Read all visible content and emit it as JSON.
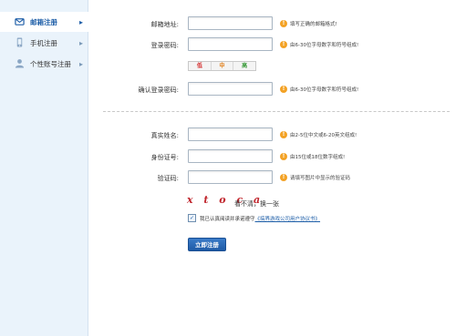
{
  "sidebar": {
    "items": [
      {
        "label": "邮箱注册",
        "icon": "mail-icon",
        "active": true
      },
      {
        "label": "手机注册",
        "icon": "phone-icon",
        "active": false
      },
      {
        "label": "个性账号注册",
        "icon": "user-icon",
        "active": false
      }
    ],
    "chevron": "▸"
  },
  "form": {
    "email": {
      "label": "邮箱地址:",
      "value": "",
      "hint": "填写正确的邮箱格式!"
    },
    "password": {
      "label": "登录密码:",
      "value": "",
      "hint": "由6-30位字母数字和符号组成!"
    },
    "strength": {
      "weak": "低",
      "medium": "中",
      "strong": "高"
    },
    "confirm_password": {
      "label": "确认登录密码:",
      "value": "",
      "hint": "由6-30位字母数字和符号组成!"
    },
    "real_name": {
      "label": "真实姓名:",
      "value": "",
      "hint": "由2-5位中文或6-20英文组成!"
    },
    "id_number": {
      "label": "身份证号:",
      "value": "",
      "hint": "由15位或18位数字组成!"
    },
    "captcha_code": {
      "label": "验证码:",
      "value": "",
      "hint": "请填写图片中显示的验证码"
    },
    "captcha_text": "x t o c a",
    "refresh_label": "看不清，换一张",
    "agreement_text": "我已认真阅读并承诺遵守",
    "agreement_link": "《搞界游戏公司用户协议书》",
    "agreement_checked": true,
    "submit_label": "立即注册"
  },
  "colors": {
    "accent": "#1f5fa8",
    "sidebar_bg": "#eaf3fb",
    "warning": "#f3a225",
    "captcha": "#c0262d",
    "strength_weak": "#d42b2b",
    "strength_medium": "#e07a10",
    "strength_strong": "#3a9a3a"
  }
}
